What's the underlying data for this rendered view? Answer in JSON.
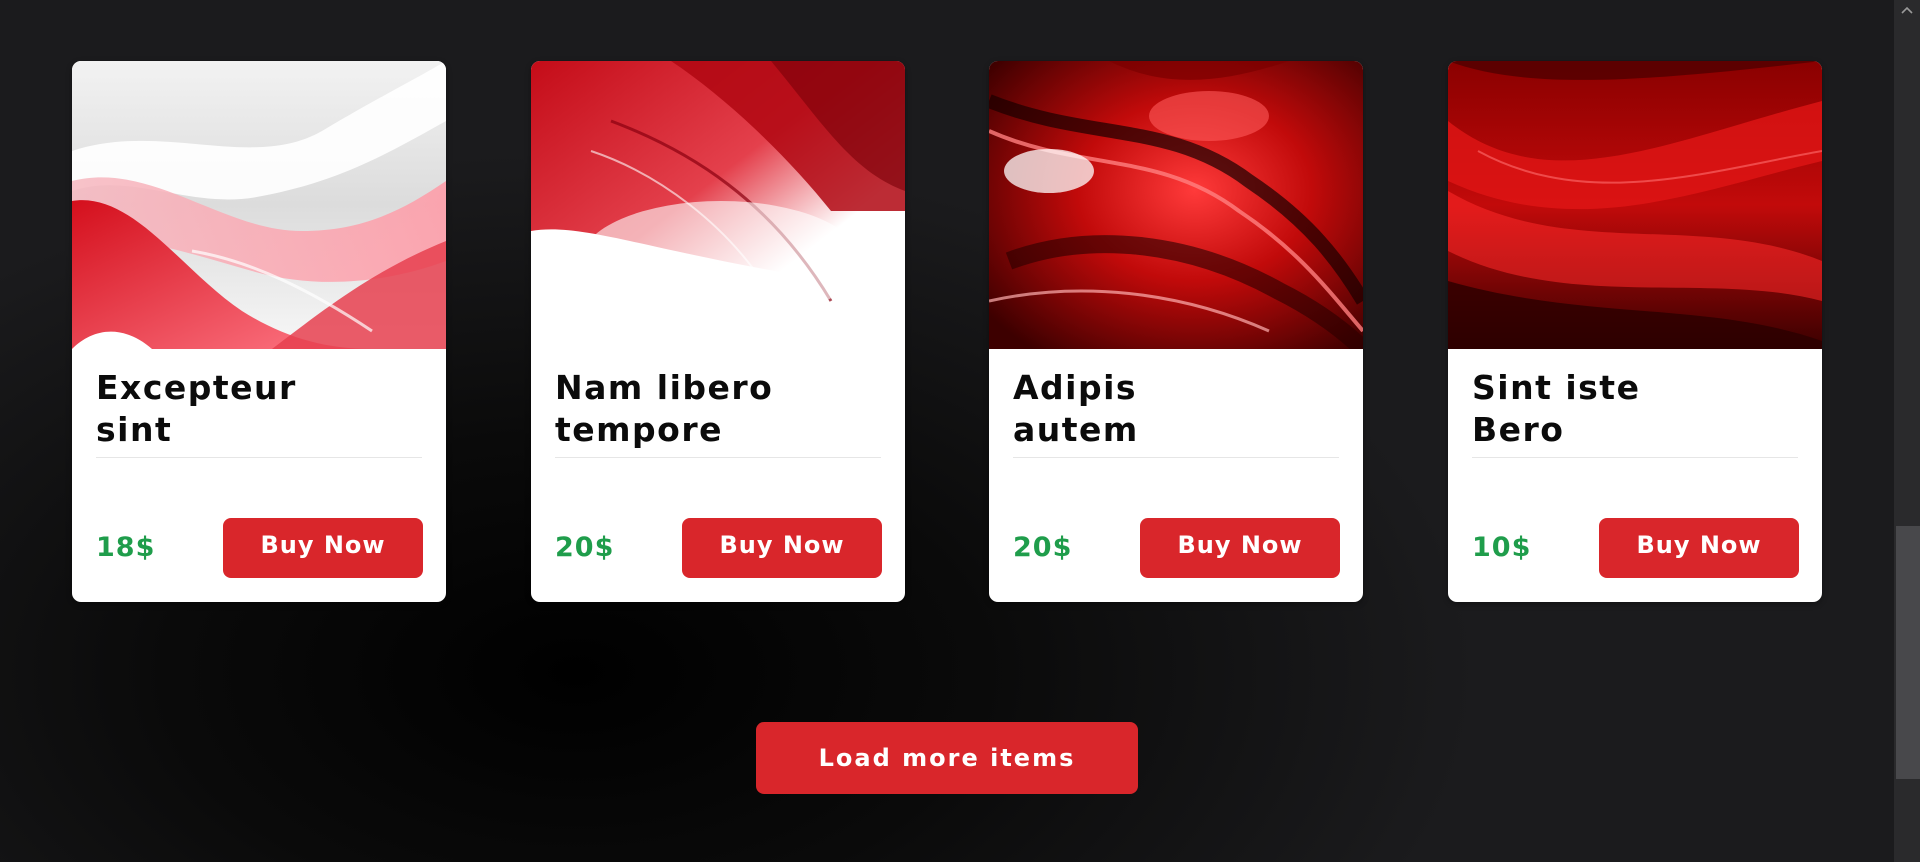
{
  "products": [
    {
      "title_line1": "Excepteur",
      "title_line2": "sint",
      "price": "18$",
      "button_label": "Buy Now",
      "image": "red-white-wave-abstract"
    },
    {
      "title_line1": "Nam libero",
      "title_line2": "tempore",
      "price": "20$",
      "button_label": "Buy Now",
      "image": "red-white-silk-abstract"
    },
    {
      "title_line1": "Adipis",
      "title_line2": "autem",
      "price": "20$",
      "button_label": "Buy Now",
      "image": "glossy-red-swirl-abstract"
    },
    {
      "title_line1": "Sint iste",
      "title_line2": "Bero",
      "price": "10$",
      "button_label": "Buy Now",
      "image": "dark-red-wave-abstract"
    }
  ],
  "load_more_label": "Load more items",
  "colors": {
    "accent": "#d9262b",
    "price": "#1f9d4b",
    "card_background": "#ffffff",
    "page_background": "#0a0a0a"
  },
  "icons": {
    "scroll_up": "chevron-up-icon"
  }
}
